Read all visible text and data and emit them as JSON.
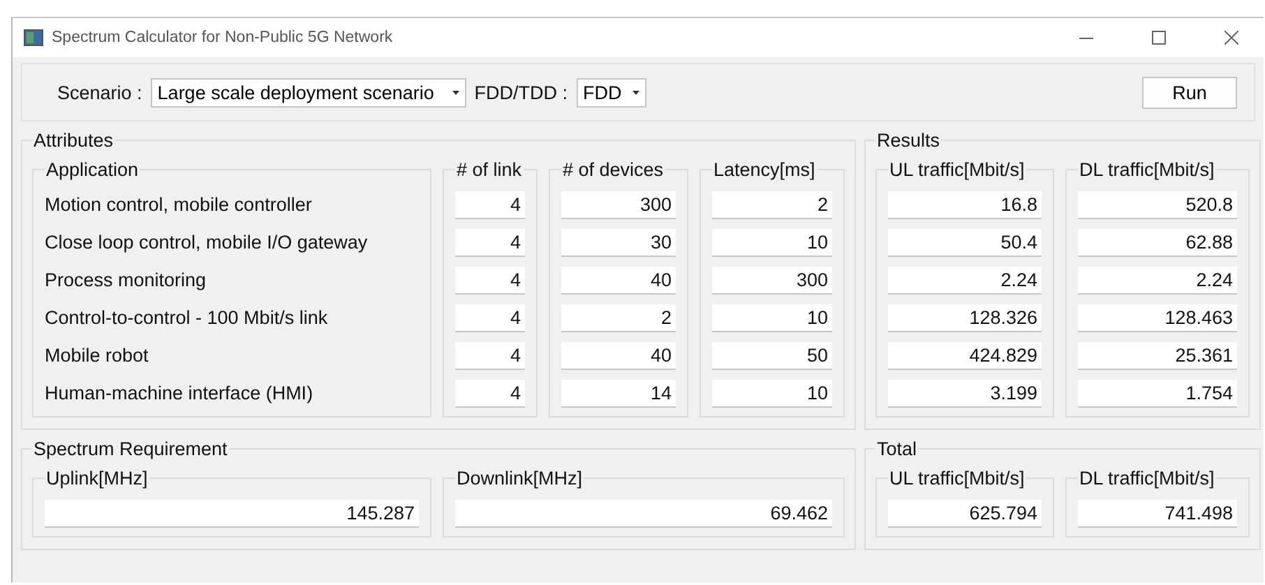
{
  "window": {
    "title": "Spectrum Calculator for Non-Public 5G Network"
  },
  "toolbar": {
    "scenario_label": "Scenario :",
    "scenario": "Large scale deployment scenario",
    "duplex_label": "FDD/TDD :",
    "duplex": "FDD",
    "run_button": "Run"
  },
  "attributes": {
    "title": "Attributes",
    "columns": [
      "Application",
      "# of link",
      "# of devices",
      "Latency[ms]"
    ],
    "rows": [
      {
        "application": "Motion control, mobile controller",
        "links": "4",
        "devices": "300",
        "latency": "2"
      },
      {
        "application": "Close loop control, mobile I/O gateway",
        "links": "4",
        "devices": "30",
        "latency": "10"
      },
      {
        "application": "Process monitoring",
        "links": "4",
        "devices": "40",
        "latency": "300"
      },
      {
        "application": "Control-to-control - 100 Mbit/s link",
        "links": "4",
        "devices": "2",
        "latency": "10"
      },
      {
        "application": "Mobile robot",
        "links": "4",
        "devices": "40",
        "latency": "50"
      },
      {
        "application": "Human-machine interface (HMI)",
        "links": "4",
        "devices": "14",
        "latency": "10"
      }
    ]
  },
  "results": {
    "title": "Results",
    "columns": [
      "UL traffic[Mbit/s]",
      "DL traffic[Mbit/s]"
    ],
    "rows": [
      {
        "ul": "16.8",
        "dl": "520.8"
      },
      {
        "ul": "50.4",
        "dl": "62.88"
      },
      {
        "ul": "2.24",
        "dl": "2.24"
      },
      {
        "ul": "128.326",
        "dl": "128.463"
      },
      {
        "ul": "424.829",
        "dl": "25.361"
      },
      {
        "ul": "3.199",
        "dl": "1.754"
      }
    ]
  },
  "spectrum_requirement": {
    "title": "Spectrum Requirement",
    "uplink_label": "Uplink[MHz]",
    "uplink": "145.287",
    "downlink_label": "Downlink[MHz]",
    "downlink": "69.462"
  },
  "total": {
    "title": "Total",
    "ul_label": "UL traffic[Mbit/s]",
    "ul": "625.794",
    "dl_label": "DL traffic[Mbit/s]",
    "dl": "741.498"
  }
}
